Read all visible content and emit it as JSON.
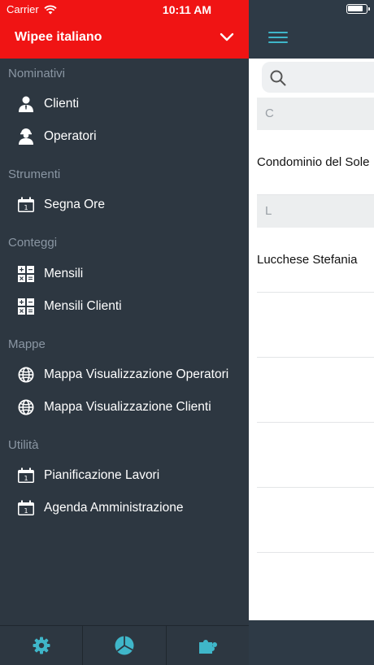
{
  "status": {
    "carrier": "Carrier",
    "time": "10:11 AM"
  },
  "drawer": {
    "title": "Wipee italiano",
    "groups": [
      {
        "label": "Nominativi",
        "items": [
          {
            "label": "Clienti",
            "icon": "person-icon"
          },
          {
            "label": "Operatori",
            "icon": "worker-icon"
          }
        ]
      },
      {
        "label": "Strumenti",
        "items": [
          {
            "label": "Segna Ore",
            "icon": "calendar-icon"
          }
        ]
      },
      {
        "label": "Conteggi",
        "items": [
          {
            "label": "Mensili",
            "icon": "calculator-icon"
          },
          {
            "label": "Mensili Clienti",
            "icon": "calculator-icon"
          }
        ]
      },
      {
        "label": "Mappe",
        "items": [
          {
            "label": "Mappa Visualizzazione Operatori",
            "icon": "globe-icon"
          },
          {
            "label": "Mappa Visualizzazione Clienti",
            "icon": "globe-icon"
          }
        ]
      },
      {
        "label": "Utilità",
        "items": [
          {
            "label": "Pianificazione Lavori",
            "icon": "calendar-icon"
          },
          {
            "label": "Agenda Amministrazione",
            "icon": "calendar-icon"
          }
        ]
      }
    ],
    "bottom_tabs": [
      "gear-icon",
      "pie-chart-icon",
      "puzzle-icon"
    ]
  },
  "content": {
    "sections": [
      {
        "letter": "C",
        "items": [
          "Condominio del Sole"
        ]
      },
      {
        "letter": "L",
        "items": [
          "Lucchese Stefania"
        ]
      }
    ]
  },
  "colors": {
    "brand_red": "#f01414",
    "drawer_bg": "#2d3741",
    "accent_teal": "#3fb6c9"
  }
}
